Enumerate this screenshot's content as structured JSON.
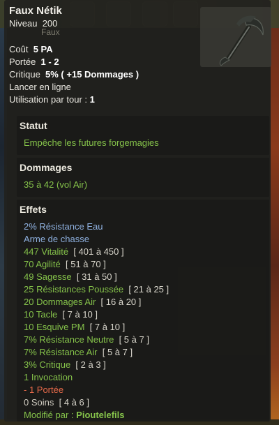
{
  "background_label": "Faux",
  "item": {
    "name": "Faux Nétik",
    "level_label": "Niveau",
    "level_value": "200"
  },
  "stats": [
    {
      "label": "Coût",
      "value": "5 PA"
    },
    {
      "label": "Portée",
      "value": "1 - 2"
    },
    {
      "label": "Critique",
      "value": "5% ( +15 Dommages )"
    },
    {
      "label": "Lancer en ligne",
      "value": ""
    },
    {
      "label": "Utilisation par tour :",
      "value": "1"
    }
  ],
  "statut": {
    "title": "Statut",
    "text": "Empêche les futures forgemagies"
  },
  "dommages": {
    "title": "Dommages",
    "text": "35 à 42 (vol Air)"
  },
  "effets": {
    "title": "Effets",
    "lines": [
      {
        "text": "2% Résistance Eau",
        "range": "",
        "color": "#8fb1e0"
      },
      {
        "text": "Arme de chasse",
        "range": "",
        "color": "#8fb1e0"
      },
      {
        "text": "447 Vitalité",
        "range": "[ 401 à 450 ]",
        "color": "#85c24a"
      },
      {
        "text": "70 Agilité",
        "range": "[ 51 à 70 ]",
        "color": "#85c24a"
      },
      {
        "text": "49 Sagesse",
        "range": "[ 31 à 50 ]",
        "color": "#85c24a"
      },
      {
        "text": "25 Résistances Poussée",
        "range": "[ 21 à 25 ]",
        "color": "#85c24a"
      },
      {
        "text": "20 Dommages Air",
        "range": "[ 16 à 20 ]",
        "color": "#85c24a"
      },
      {
        "text": "10 Tacle",
        "range": "[ 7 à 10 ]",
        "color": "#85c24a"
      },
      {
        "text": "10 Esquive PM",
        "range": "[ 7 à 10 ]",
        "color": "#85c24a"
      },
      {
        "text": "7% Résistance Neutre",
        "range": "[ 5 à 7 ]",
        "color": "#85c24a"
      },
      {
        "text": "7% Résistance Air",
        "range": "[ 5 à 7 ]",
        "color": "#85c24a"
      },
      {
        "text": "3% Critique",
        "range": "[ 2 à 3 ]",
        "color": "#85c24a"
      },
      {
        "text": "1 Invocation",
        "range": "",
        "color": "#85c24a"
      },
      {
        "text": "- 1 Portée",
        "range": "",
        "color": "#e76a4a"
      },
      {
        "text": "0 Soins",
        "range": "[ 4 à 6 ]",
        "color": "#cfcbc0"
      }
    ],
    "modified_label": "Modifié par :",
    "modified_by": "Pioutelefils"
  },
  "icons": {
    "weapon": "scythe-icon"
  }
}
